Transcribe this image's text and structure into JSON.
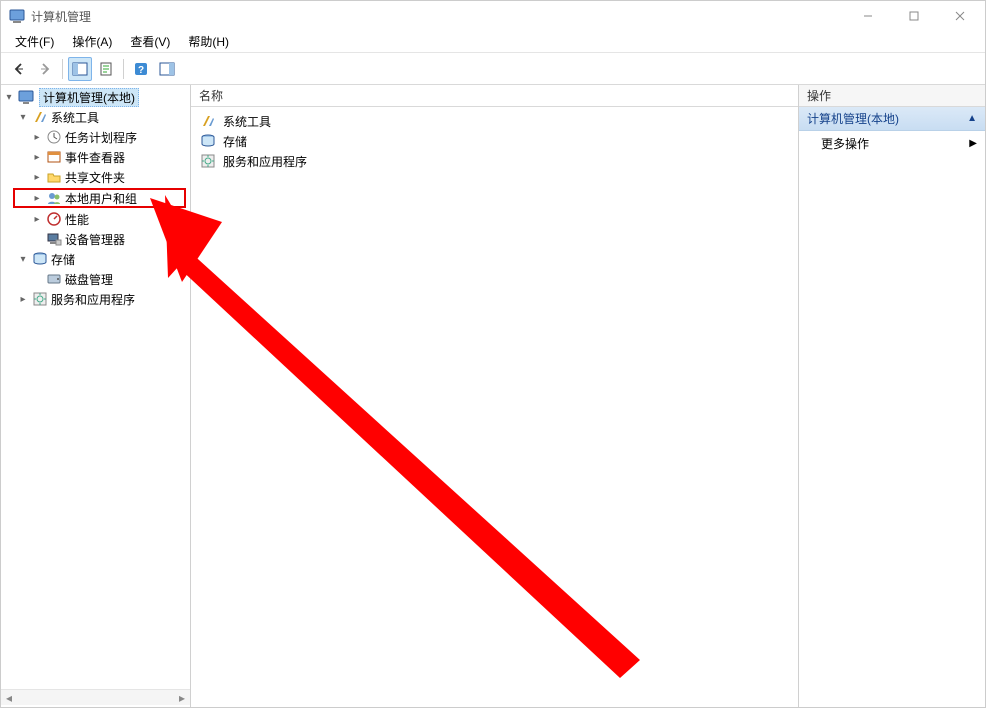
{
  "window": {
    "title": "计算机管理"
  },
  "menu": {
    "file": "文件(F)",
    "action": "操作(A)",
    "view": "查看(V)",
    "help": "帮助(H)"
  },
  "tree": {
    "root": "计算机管理(本地)",
    "system_tools": "系统工具",
    "task_scheduler": "任务计划程序",
    "event_viewer": "事件查看器",
    "shared_folders": "共享文件夹",
    "local_users": "本地用户和组",
    "performance": "性能",
    "device_manager": "设备管理器",
    "storage": "存储",
    "disk_management": "磁盘管理",
    "services_apps": "服务和应用程序"
  },
  "list": {
    "header_name": "名称",
    "rows": {
      "r1": "系统工具",
      "r2": "存储",
      "r3": "服务和应用程序"
    }
  },
  "actions": {
    "header": "操作",
    "section": "计算机管理(本地)",
    "more": "更多操作"
  }
}
